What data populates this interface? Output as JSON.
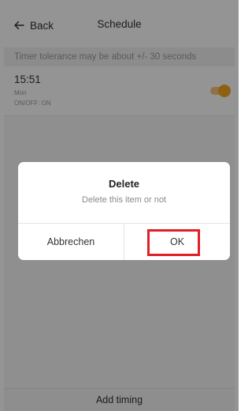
{
  "header": {
    "back_label": "Back",
    "back_icon": "arrow-left-icon",
    "title": "Schedule"
  },
  "notice": {
    "text": "Timer tolerance may be about +/- 30 seconds"
  },
  "schedule_items": [
    {
      "time": "15:51",
      "days": "Mon",
      "action": "ON/OFF: ON",
      "enabled": true
    }
  ],
  "footer": {
    "add_label": "Add timing"
  },
  "dialog": {
    "title": "Delete",
    "message": "Delete this item or not",
    "cancel_label": "Abbrechen",
    "ok_label": "OK"
  },
  "colors": {
    "toggle_on": "#f5a623",
    "highlight": "#e01f26"
  }
}
